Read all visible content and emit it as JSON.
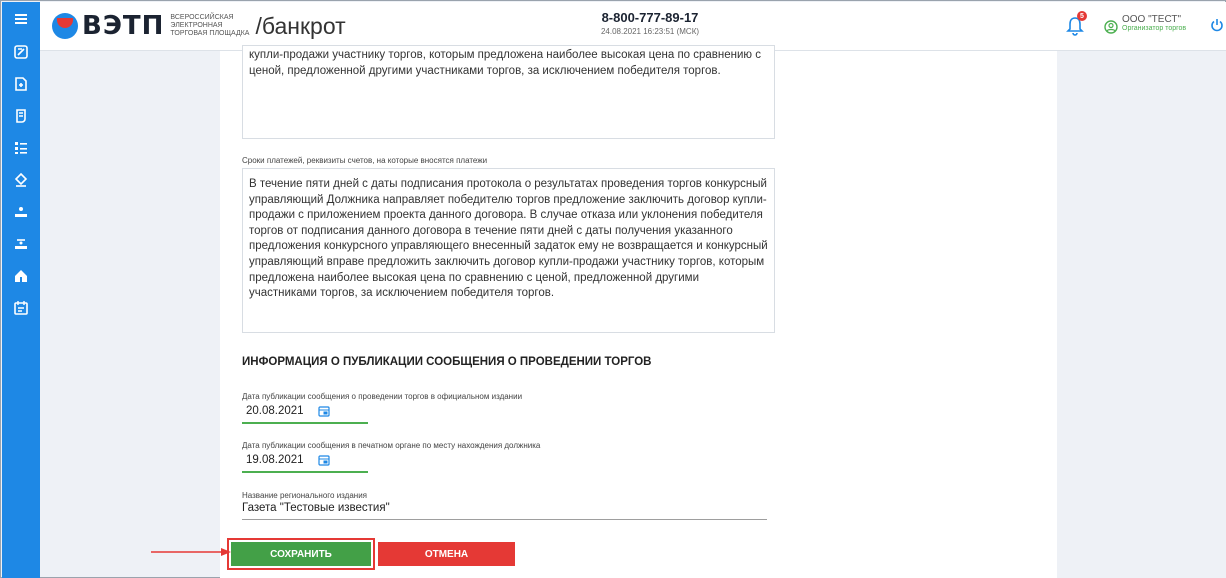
{
  "header": {
    "logo_text": "ВЭТП",
    "logo_subtitle": [
      "ВСЕРОССИЙСКАЯ",
      "ЭЛЕКТРОННАЯ",
      "ТОРГОВАЯ ПЛОЩАДКА"
    ],
    "section": "/банкрот",
    "phone": "8-800-777-89-17",
    "datetime": "24.08.2021 16:23:51 (МСК)",
    "notifications_count": "5",
    "user_name": "ООО \"ТЕСТ\"",
    "user_role": "Организатор торгов"
  },
  "form": {
    "text_block_1": "купли-продажи участнику торгов, которым предложена наиболее высокая цена по сравнению с ценой, предложенной другими участниками торгов, за исключением победителя торгов.",
    "payments_label": "Сроки платежей, реквизиты счетов, на которые вносятся платежи",
    "payments_text": "В течение пяти дней с даты подписания протокола о результатах проведения торгов конкурсный управляющий Должника направляет победителю торгов предложение заключить договор купли-продажи с приложением проекта данного договора. В случае отказа или уклонения победителя торгов от подписания данного договора в течение пяти дней с даты получения указанного предложения конкурсного управляющего внесенный задаток ему не возвращается и конкурсный управляющий вправе предложить заключить договор купли-продажи участнику торгов, которым предложена наиболее высокая цена по сравнению с ценой, предложенной другими участниками торгов, за исключением победителя торгов.",
    "section_title": "ИНФОРМАЦИЯ О ПУБЛИКАЦИИ СООБЩЕНИЯ О ПРОВЕДЕНИИ ТОРГОВ",
    "official_date_label": "Дата публикации сообщения о проведении торгов в официальном издании",
    "official_date_value": "20.08.2021",
    "print_date_label": "Дата публикации сообщения в печатном органе по месту нахождения должника",
    "print_date_value": "19.08.2021",
    "regional_label": "Название регионального издания",
    "regional_value": "Газета \"Тестовые известия\"",
    "save_label": "СОХРАНИТЬ",
    "cancel_label": "ОТМЕНА"
  },
  "colors": {
    "sidebar": "#1e88e5",
    "save": "#43a047",
    "cancel": "#e53935",
    "highlight": "#e53935"
  },
  "sidebar_icons": [
    "menu-icon",
    "auctions-icon",
    "documents-icon",
    "lots-icon",
    "list-icon",
    "tender-icon",
    "bidder-icon",
    "buyer-icon",
    "home-icon",
    "calendar-icon"
  ]
}
